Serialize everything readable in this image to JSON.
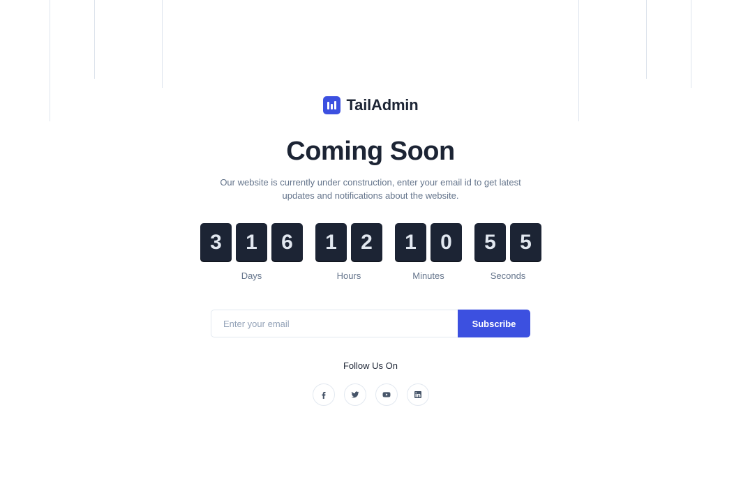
{
  "brand": {
    "name": "TailAdmin"
  },
  "hero": {
    "title": "Coming Soon",
    "description": "Our website is currently under construction, enter your email id to get latest updates and notifications about the website."
  },
  "countdown": {
    "days": {
      "digits": [
        "3",
        "1",
        "6"
      ],
      "label": "Days"
    },
    "hours": {
      "digits": [
        "1",
        "2"
      ],
      "label": "Hours"
    },
    "minutes": {
      "digits": [
        "1",
        "0"
      ],
      "label": "Minutes"
    },
    "seconds": {
      "digits": [
        "5",
        "5"
      ],
      "label": "Seconds"
    }
  },
  "subscribe": {
    "placeholder": "Enter your email",
    "value": "",
    "button_label": "Subscribe"
  },
  "social": {
    "heading": "Follow Us On",
    "icons": [
      "facebook-icon",
      "twitter-icon",
      "youtube-icon",
      "linkedin-icon"
    ]
  },
  "colors": {
    "accent": "#3c50e0",
    "digit_bg": "#1c2434",
    "text_dark": "#1c2434",
    "text_muted": "#64748b"
  }
}
